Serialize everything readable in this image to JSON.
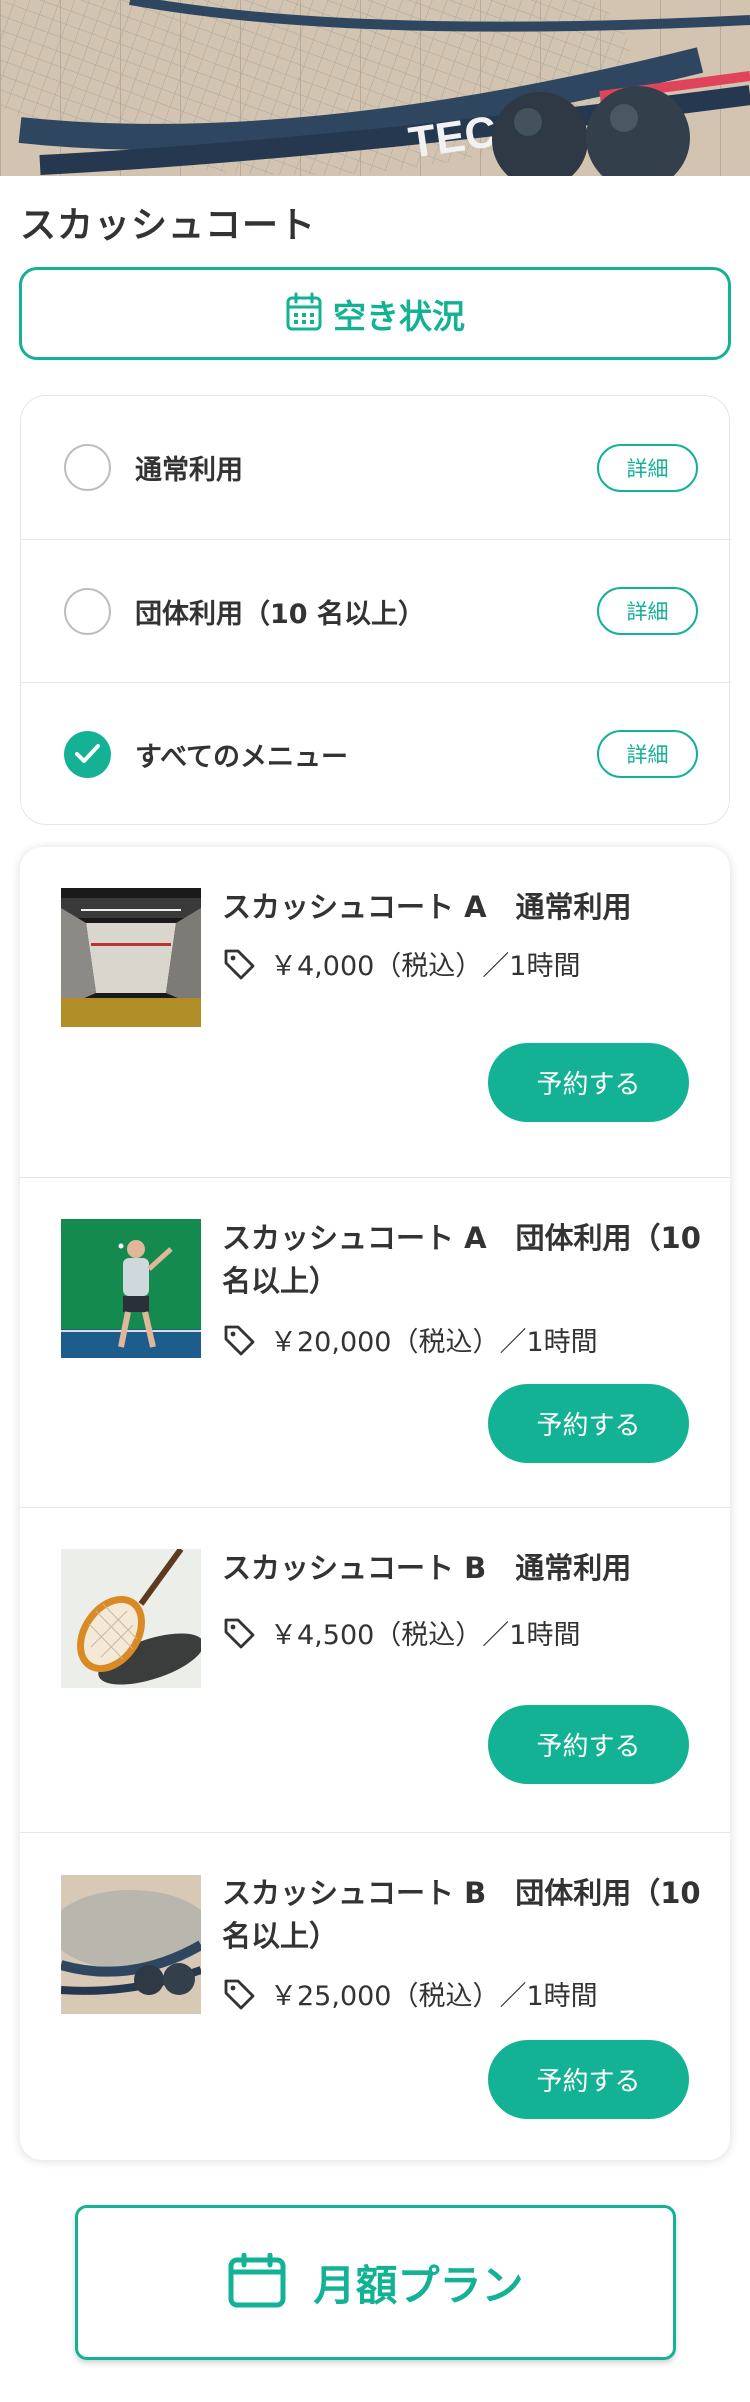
{
  "hero": {
    "image": "squash-racket-balls-photo",
    "racket_text": "TEC"
  },
  "page": {
    "title": "スカッシュコート"
  },
  "availability": {
    "label": "空き状況",
    "icon": "calendar-icon"
  },
  "menu_filters": {
    "detail_label": "詳細",
    "items": [
      {
        "label": "通常利用",
        "checked": false
      },
      {
        "label": "団体利用（10 名以上）",
        "checked": false
      },
      {
        "label": "すべてのメニュー",
        "checked": true
      }
    ]
  },
  "plans": [
    {
      "name": "スカッシュコート A　通常利用",
      "price": "￥4,000（税込）／1時間",
      "reserve_label": "予約する",
      "image": "indoor-court-photo"
    },
    {
      "name": "スカッシュコート A　団体利用（10 名以上）",
      "price": "￥20,000（税込）／1時間",
      "reserve_label": "予約する",
      "image": "player-green-wall-photo"
    },
    {
      "name": "スカッシュコート B　通常利用",
      "price": "￥4,500（税込）／1時間",
      "reserve_label": "予約する",
      "image": "racket-shadow-photo"
    },
    {
      "name": "スカッシュコート B　団体利用（10 名以上）",
      "price": "￥25,000（税込）／1時間",
      "reserve_label": "予約する",
      "image": "rackets-balls-photo"
    }
  ],
  "monthly_plan": {
    "label": "月額プラン",
    "icon": "calendar-icon"
  },
  "colors": {
    "accent": "#13b294",
    "text": "#333333",
    "border": "#e6e6e6"
  }
}
